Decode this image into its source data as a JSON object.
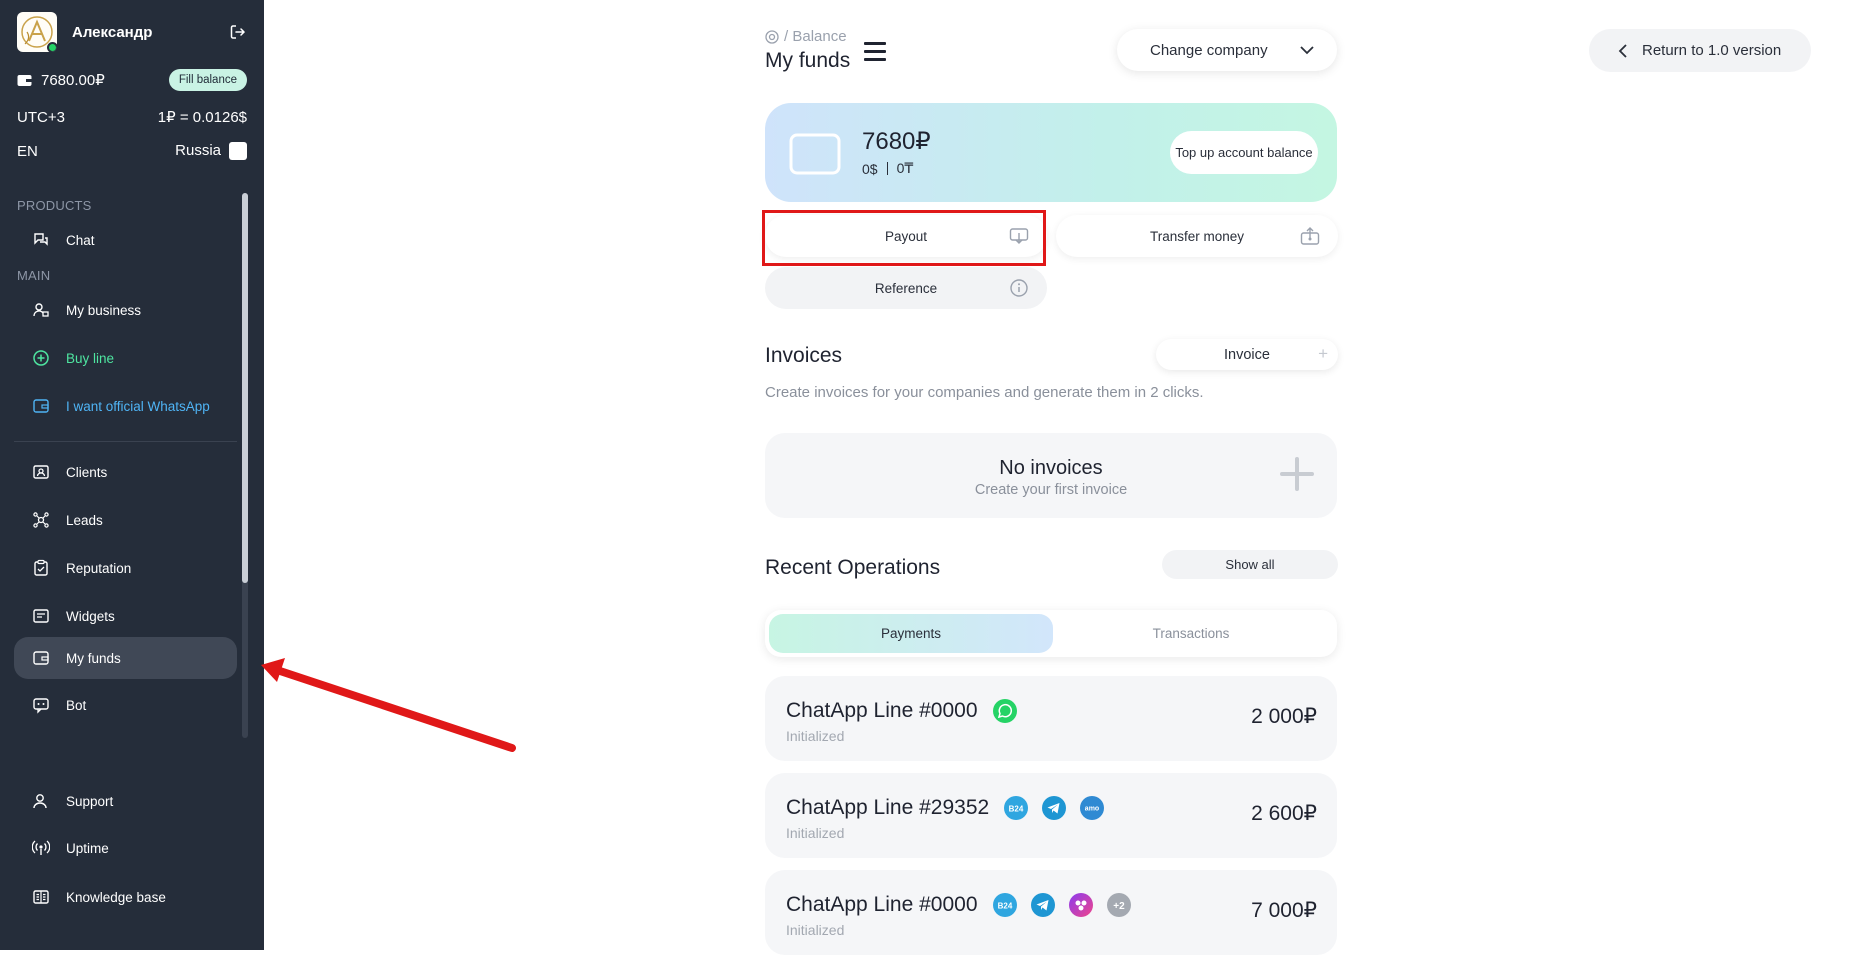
{
  "sidebar": {
    "user_name": "Александр",
    "balance": "7680.00₽",
    "fill_balance": "Fill balance",
    "timezone": "UTC+3",
    "rate": "1₽ = 0.0126$",
    "language": "EN",
    "country": "Russia",
    "products_label": "PRODUCTS",
    "main_label": "MAIN",
    "items": [
      {
        "label": "Chat",
        "icon": "chat-icon"
      },
      {
        "label": "My business",
        "icon": "business-icon"
      },
      {
        "label": "Buy line",
        "icon": "plus-circle-icon"
      },
      {
        "label": "I want official WhatsApp",
        "icon": "wallet-icon"
      },
      {
        "label": "Clients",
        "icon": "contacts-icon"
      },
      {
        "label": "Leads",
        "icon": "leads-icon"
      },
      {
        "label": "Reputation",
        "icon": "clipboard-icon"
      },
      {
        "label": "Widgets",
        "icon": "widget-icon"
      },
      {
        "label": "My funds",
        "icon": "wallet-icon"
      },
      {
        "label": "Bot",
        "icon": "bot-icon"
      },
      {
        "label": "Support",
        "icon": "support-icon"
      },
      {
        "label": "Uptime",
        "icon": "uptime-icon"
      },
      {
        "label": "Knowledge base",
        "icon": "book-icon"
      }
    ],
    "colors": {
      "bg": "#252d3a",
      "green": "#4ee5a0",
      "blue": "#4fb4f5",
      "active": "#404856"
    }
  },
  "header": {
    "breadcrumb": "Balance",
    "title": "My funds",
    "company_btn": "Change company",
    "return_btn": "Return to 1.0 version"
  },
  "balance_card": {
    "amount": "7680₽",
    "usd": "0$",
    "kzt": "0₸",
    "topup": "Top up account balance"
  },
  "actions": {
    "payout": "Payout",
    "transfer": "Transfer money",
    "reference": "Reference"
  },
  "invoices": {
    "title": "Invoices",
    "button": "Invoice",
    "description": "Create invoices for your companies and generate them in 2 clicks.",
    "empty_title": "No invoices",
    "empty_sub": "Create your first invoice"
  },
  "operations": {
    "title": "Recent Operations",
    "show_all": "Show all",
    "tabs": [
      "Payments",
      "Transactions"
    ],
    "items": [
      {
        "name": "ChatApp Line #0000",
        "status": "Initialized",
        "amount": "2 000₽"
      },
      {
        "name": "ChatApp Line #29352",
        "status": "Initialized",
        "amount": "2 600₽"
      },
      {
        "name": "ChatApp Line #0000",
        "status": "Initialized",
        "amount": "7 000₽",
        "extra": "+2"
      }
    ]
  },
  "annotation": {
    "highlight_color": "#e01818"
  }
}
